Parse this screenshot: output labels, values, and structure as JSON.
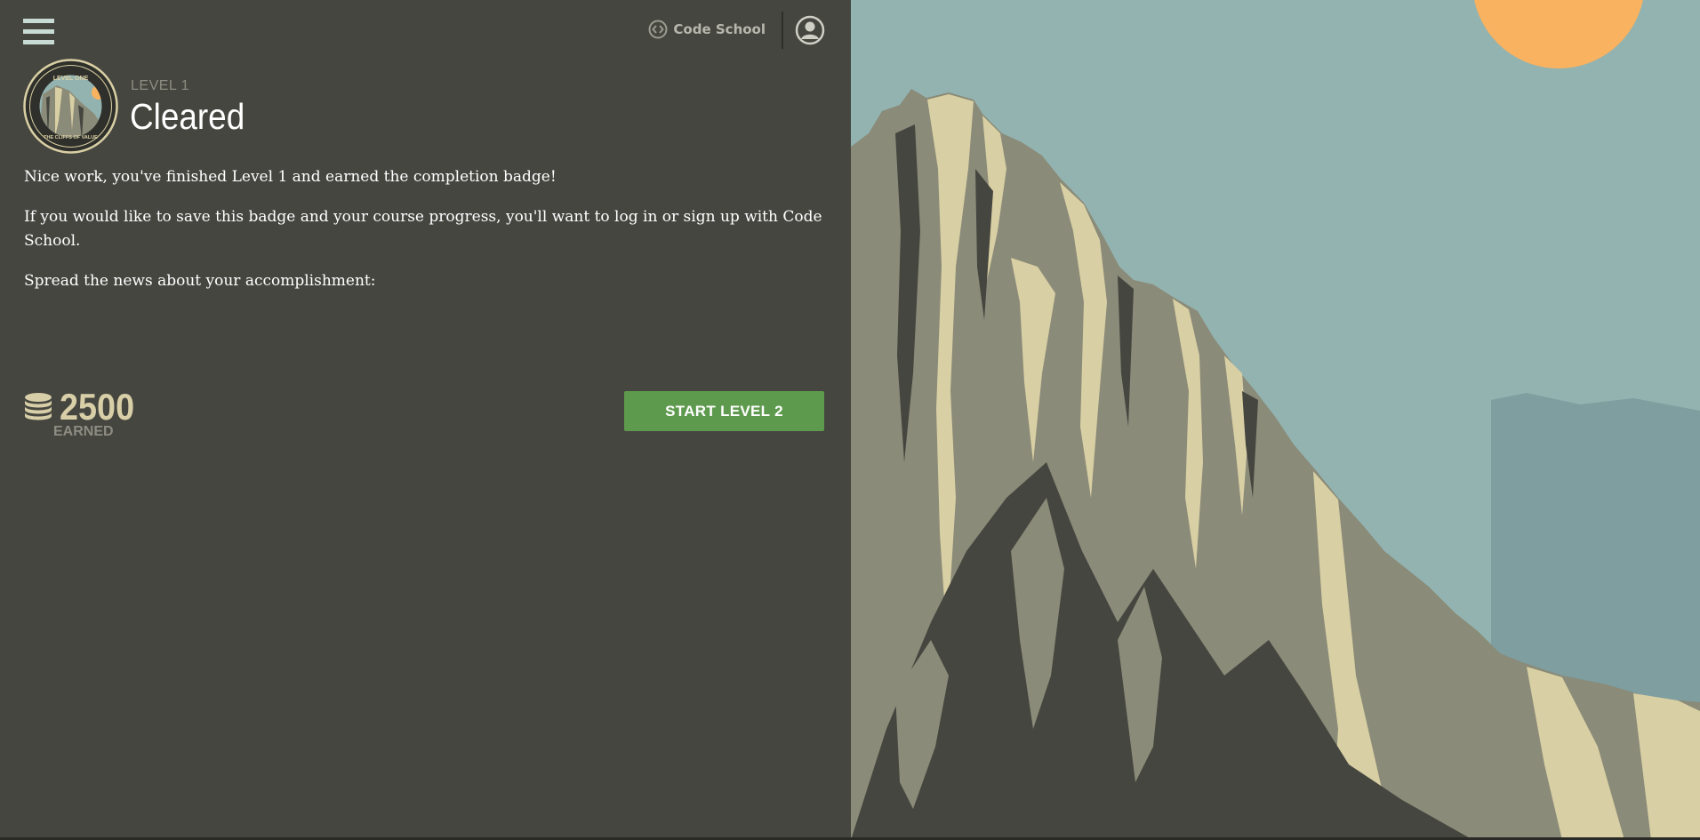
{
  "header": {
    "menu_icon": "hamburger-menu-icon",
    "brand_icon": "code-brackets-icon",
    "brand_label": "Code School",
    "user_icon": "user-avatar-icon"
  },
  "badge": {
    "top_text": "LEVEL ONE",
    "bottom_text": "THE CLIFFS OF VALUE"
  },
  "level": {
    "label": "LEVEL 1",
    "title": "Cleared"
  },
  "content": {
    "paragraph_1": "Nice work, you've finished Level 1 and earned the completion badge!",
    "paragraph_2": "If you would like to save this badge and your course progress, you'll want to log in or sign up with Code School.",
    "paragraph_3": "Spread the news about your accomplishment:"
  },
  "points": {
    "icon": "coin-stack-icon",
    "value": "2500",
    "label": "EARNED"
  },
  "actions": {
    "start_next_label": "START LEVEL 2"
  },
  "colors": {
    "panel_bg": "#464640",
    "accent_button": "#5e9a4d",
    "points": "#d8cfa8",
    "sky": "#93b3b0",
    "sun": "#f9b25f",
    "rock_mid": "#8a8b78",
    "rock_light": "#d9cfa4",
    "rock_dark": "#464640"
  }
}
